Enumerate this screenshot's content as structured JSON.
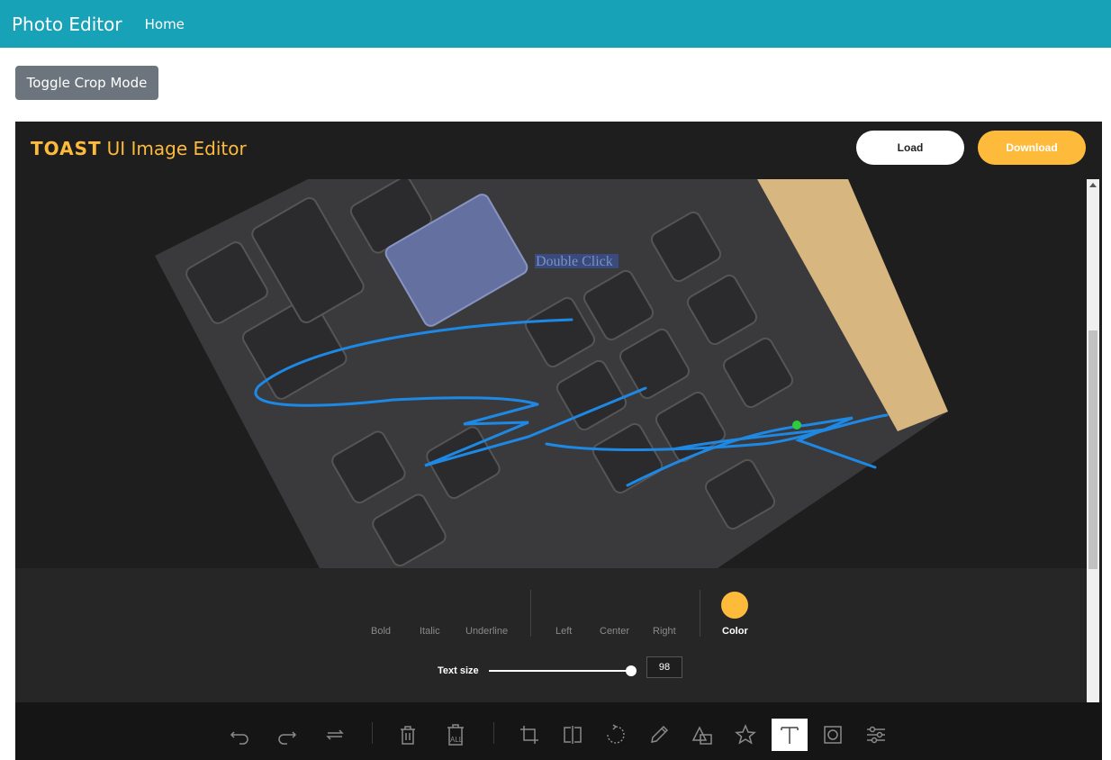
{
  "navbar": {
    "brand": "Photo Editor",
    "home_link": "Home"
  },
  "crop_toggle_label": "Toggle Crop Mode",
  "editor": {
    "logo_toast": "TOAST",
    "logo_title": "UI Image Editor",
    "load_label": "Load",
    "download_label": "Download",
    "canvas_text": "Double Click"
  },
  "text_menu": {
    "style_items": [
      "Bold",
      "Italic",
      "Underline"
    ],
    "align_items": [
      "Left",
      "Center",
      "Right"
    ],
    "color_label": "Color",
    "color_value": "#fdba3b",
    "text_size_label": "Text size",
    "text_size_value": "98",
    "text_size_fraction": 0.96
  },
  "toolbar": {
    "tools": [
      "undo-icon",
      "redo-icon",
      "reset-icon",
      "delete-icon",
      "delete-all-icon",
      "crop-icon",
      "flip-icon",
      "rotate-icon",
      "draw-icon",
      "shape-icon",
      "icon-icon",
      "text-icon",
      "mask-icon",
      "filter-icon"
    ],
    "active_tool": "text-icon",
    "delete_all_label": "ALL"
  },
  "colors": {
    "navbar": "#17a2b8",
    "accent": "#fdba3b",
    "crop_button": "#6c757d",
    "editor_bg": "#1e1e1e"
  }
}
